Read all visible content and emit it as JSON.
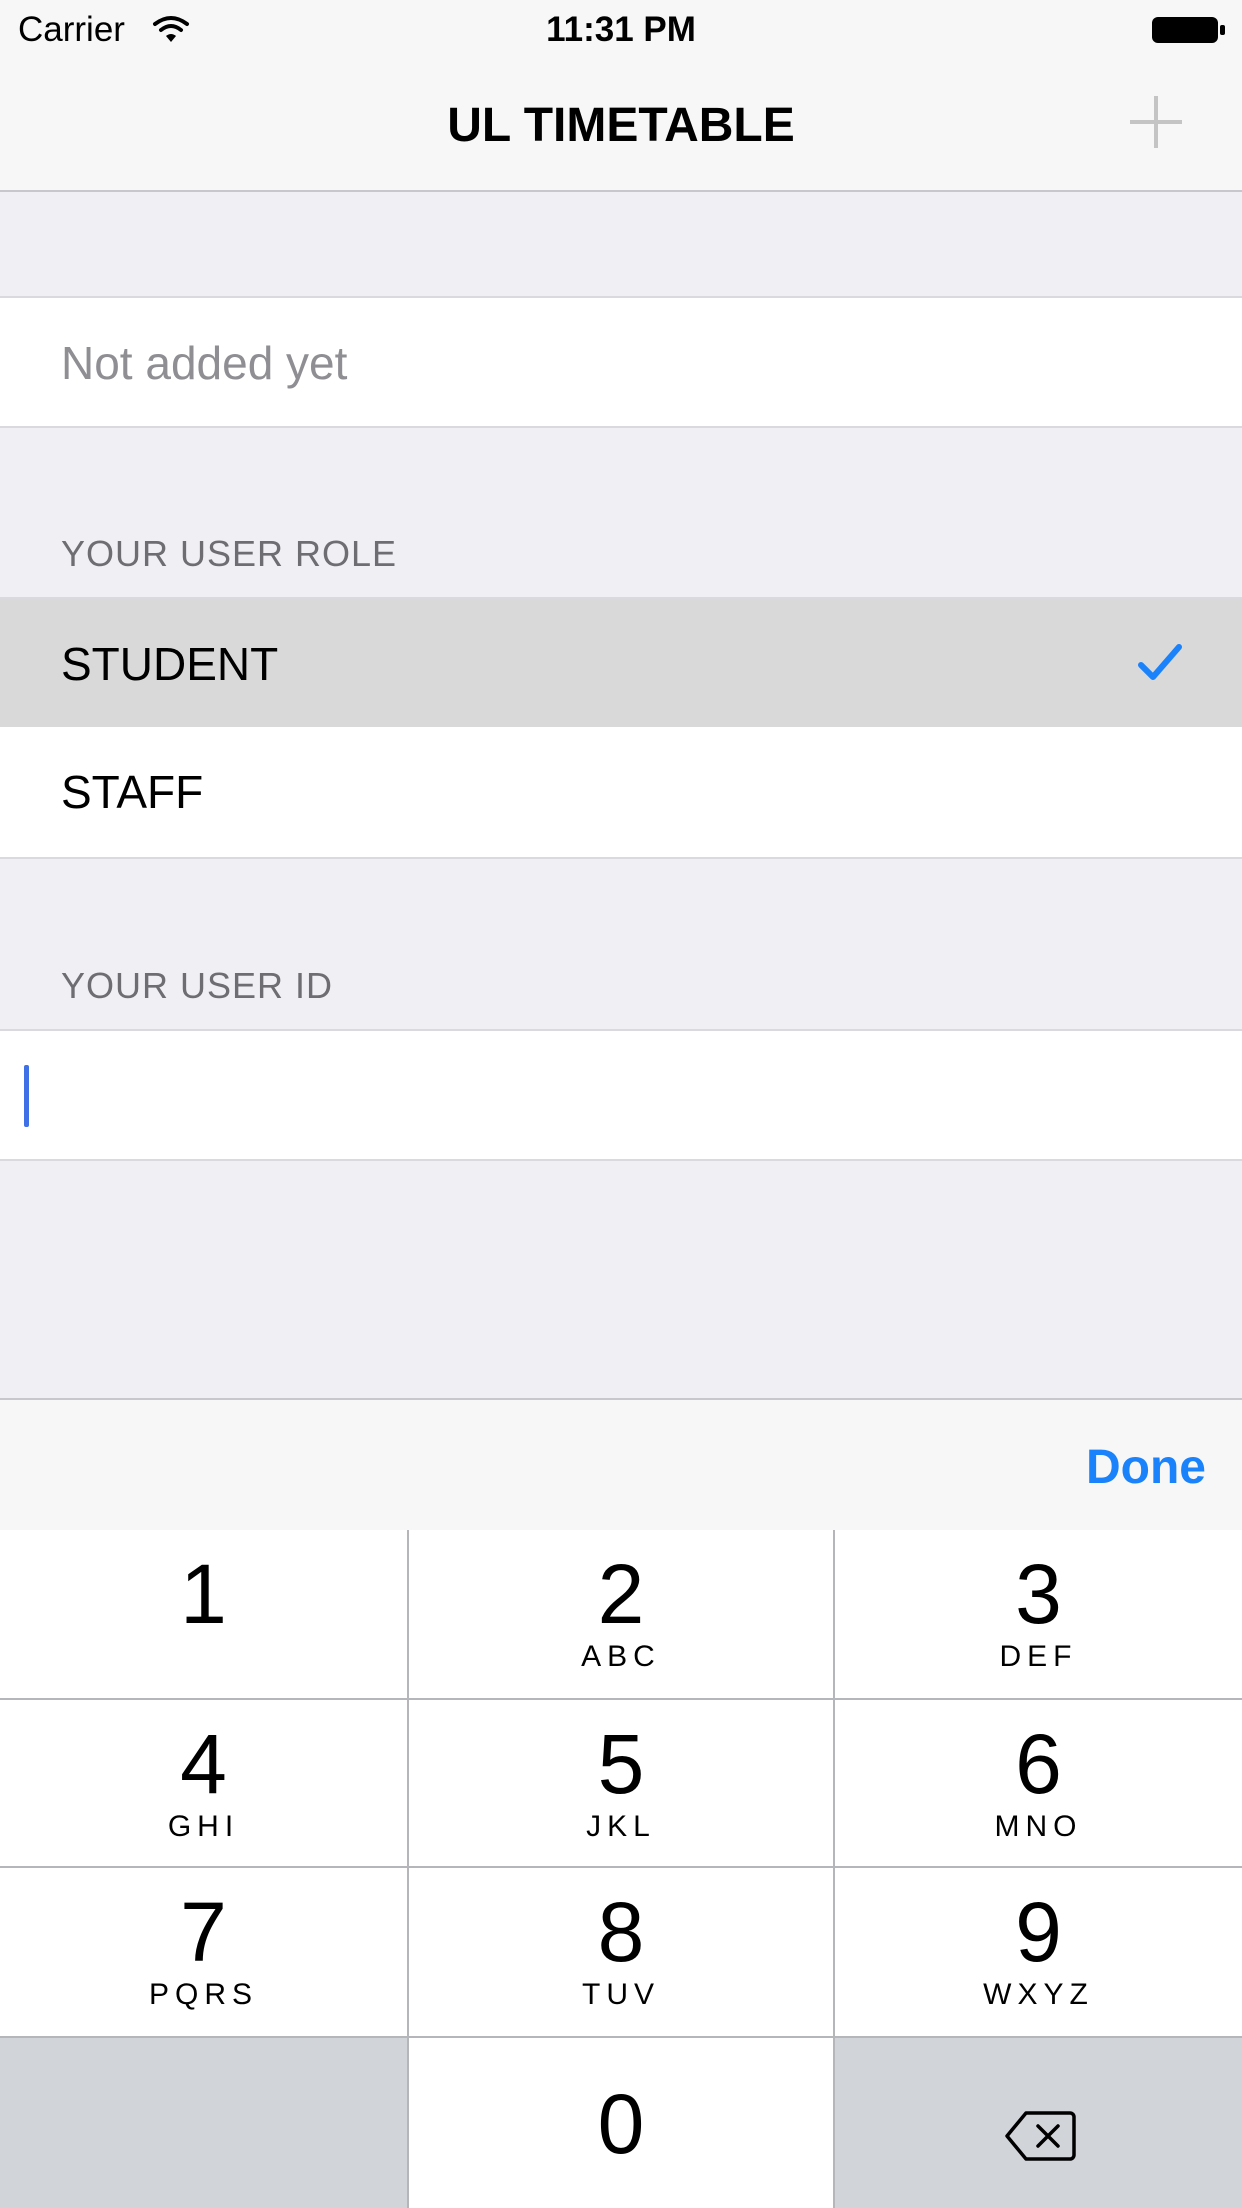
{
  "status_bar": {
    "carrier": "Carrier",
    "time": "11:31 PM"
  },
  "nav": {
    "title": "UL TIMETABLE",
    "add_icon": "plus-icon"
  },
  "course_row": {
    "placeholder": "Not added yet"
  },
  "role_section": {
    "header": "YOUR USER ROLE",
    "options": [
      {
        "label": "STUDENT",
        "selected": true
      },
      {
        "label": "STAFF",
        "selected": false
      }
    ]
  },
  "id_section": {
    "header": "YOUR USER ID",
    "value": ""
  },
  "accessory": {
    "done_label": "Done"
  },
  "keypad": {
    "keys": [
      {
        "digit": "1",
        "letters": ""
      },
      {
        "digit": "2",
        "letters": "ABC"
      },
      {
        "digit": "3",
        "letters": "DEF"
      },
      {
        "digit": "4",
        "letters": "GHI"
      },
      {
        "digit": "5",
        "letters": "JKL"
      },
      {
        "digit": "6",
        "letters": "MNO"
      },
      {
        "digit": "7",
        "letters": "PQRS"
      },
      {
        "digit": "8",
        "letters": "TUV"
      },
      {
        "digit": "9",
        "letters": "WXYZ"
      },
      {
        "digit": "0",
        "letters": ""
      }
    ],
    "delete_icon": "backspace-icon"
  },
  "colors": {
    "accent": "#1a82fb",
    "cursor": "#3f70e5",
    "selected_row": "#d9d9d9",
    "group_bg": "#efeff4"
  }
}
